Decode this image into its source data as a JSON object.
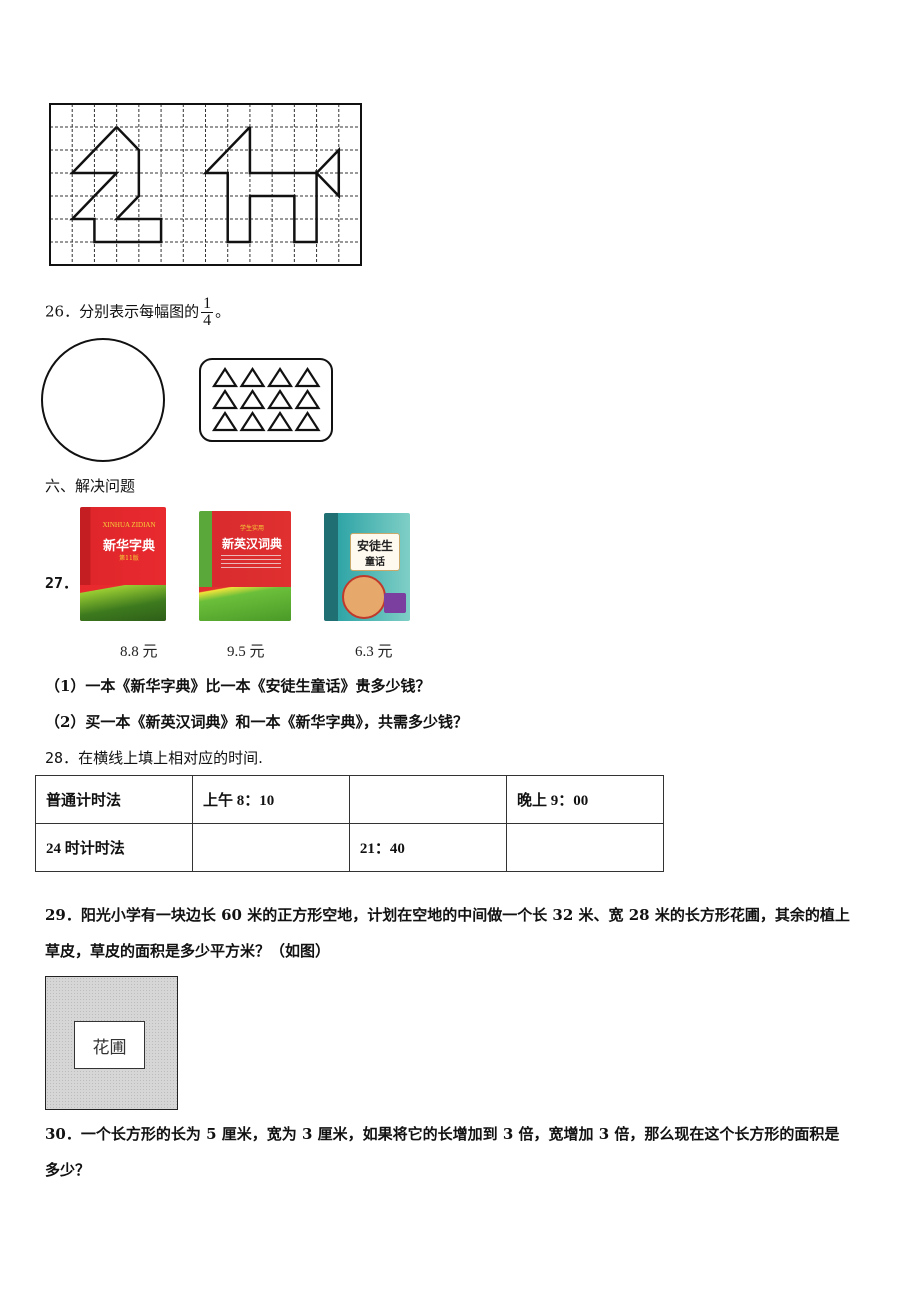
{
  "q25": {
    "grid": {
      "cols": 14,
      "rows": 7,
      "shape_1_points": [
        [
          3,
          1
        ],
        [
          4,
          2
        ],
        [
          4,
          4
        ],
        [
          3,
          5
        ],
        [
          5,
          5
        ],
        [
          5,
          6
        ],
        [
          2,
          6
        ],
        [
          2,
          5
        ],
        [
          1,
          5
        ],
        [
          3,
          3
        ],
        [
          1,
          3
        ],
        [
          3,
          1
        ]
      ],
      "shape_2_points": [
        [
          9,
          1
        ],
        [
          9,
          3
        ],
        [
          12,
          3
        ],
        [
          13,
          2
        ],
        [
          13,
          4
        ],
        [
          12,
          3
        ],
        [
          12,
          6
        ],
        [
          11,
          6
        ],
        [
          11,
          4
        ],
        [
          9,
          4
        ],
        [
          9,
          6
        ],
        [
          8,
          6
        ],
        [
          8,
          3
        ],
        [
          7,
          3
        ],
        [
          9,
          1
        ]
      ]
    }
  },
  "q26": {
    "number": "26．",
    "text": "分别表示每幅图的",
    "fraction": {
      "numerator": "1",
      "denominator": "4"
    },
    "end": "。",
    "triangle_grid": {
      "rows": 3,
      "cols": 4
    }
  },
  "section6": {
    "title": "六、解决问题"
  },
  "q27": {
    "number": "27．",
    "books": [
      {
        "name": "新华字典",
        "cover_title": "新华字典",
        "cover_sub": "XINHUA ZIDIAN",
        "edition": "第11版",
        "price": "8.8 元",
        "color": "#e0262b"
      },
      {
        "name": "新英汉词典",
        "cover_title": "新英汉词典",
        "cover_sub": "学生实用",
        "price": "9.5 元",
        "color": "#d92a2f"
      },
      {
        "name": "安徒生童话",
        "cover_title": "安徒生",
        "cover_title_2": "童话",
        "price": "6.3 元",
        "color": "#2fa4a6"
      }
    ],
    "sub_questions": [
      "（1）一本《新华字典》比一本《安徒生童话》贵多少钱？",
      "（2）买一本《新英汉词典》和一本《新华字典》，共需多少钱？"
    ]
  },
  "q28": {
    "number": "28．",
    "text": "在横线上填上相对应的时间.",
    "table": {
      "rows": [
        [
          "普通计时法",
          "上午 8：10",
          "",
          "晚上 9：00"
        ],
        [
          "24 时计时法",
          "",
          "21：40",
          ""
        ]
      ]
    }
  },
  "q29": {
    "line1": "29．阳光小学有一块边长 60 米的正方形空地，计划在空地的中间做一个长 32 米、宽 28 米的长方形花圃，其余的植上",
    "line2": "草皮，草皮的面积是多少平方米？（如图）",
    "garden_label": "花圃"
  },
  "q30": {
    "line1": "30．一个长方形的长为 5 厘米，宽为 3 厘米，如果将它的长增加到 3 倍，宽增加 3 倍，那么现在这个长方形的面积是",
    "line2": "多少？"
  }
}
